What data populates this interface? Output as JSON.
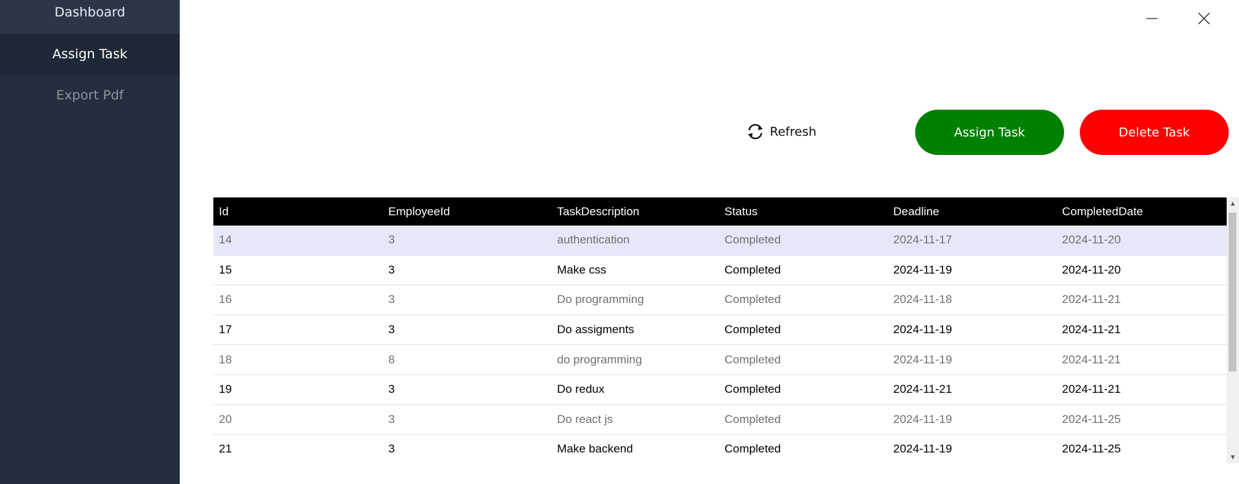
{
  "sidebar": {
    "items": [
      {
        "label": "Dashboard"
      },
      {
        "label": "Assign Task"
      },
      {
        "label": "Export Pdf"
      }
    ]
  },
  "window": {
    "minimize_icon": "minimize-icon",
    "close_icon": "close-icon"
  },
  "toolbar": {
    "refresh_label": "Refresh",
    "assign_label": "Assign Task",
    "delete_label": "Delete Task",
    "assign_color": "#008000",
    "delete_color": "#ff0000"
  },
  "grid": {
    "columns": [
      "Id",
      "EmployeeId",
      "TaskDescription",
      "Status",
      "Deadline",
      "CompletedDate"
    ],
    "rows": [
      [
        "14",
        "3",
        "authentication",
        "Completed",
        "2024-11-17",
        "2024-11-20"
      ],
      [
        "15",
        "3",
        "Make css",
        "Completed",
        "2024-11-19",
        "2024-11-20"
      ],
      [
        "16",
        "3",
        "Do programming",
        "Completed",
        "2024-11-18",
        "2024-11-21"
      ],
      [
        "17",
        "3",
        "Do assigments",
        "Completed",
        "2024-11-19",
        "2024-11-21"
      ],
      [
        "18",
        "8",
        "do programming",
        "Completed",
        "2024-11-19",
        "2024-11-21"
      ],
      [
        "19",
        "3",
        "Do redux",
        "Completed",
        "2024-11-21",
        "2024-11-21"
      ],
      [
        "20",
        "3",
        "Do react js",
        "Completed",
        "2024-11-19",
        "2024-11-25"
      ],
      [
        "21",
        "3",
        "Make backend",
        "Completed",
        "2024-11-19",
        "2024-11-25"
      ]
    ]
  },
  "colors": {
    "sidebar_bg": "#232e3f",
    "header_bg": "#000000",
    "selected_row": "#e7e7fa"
  }
}
